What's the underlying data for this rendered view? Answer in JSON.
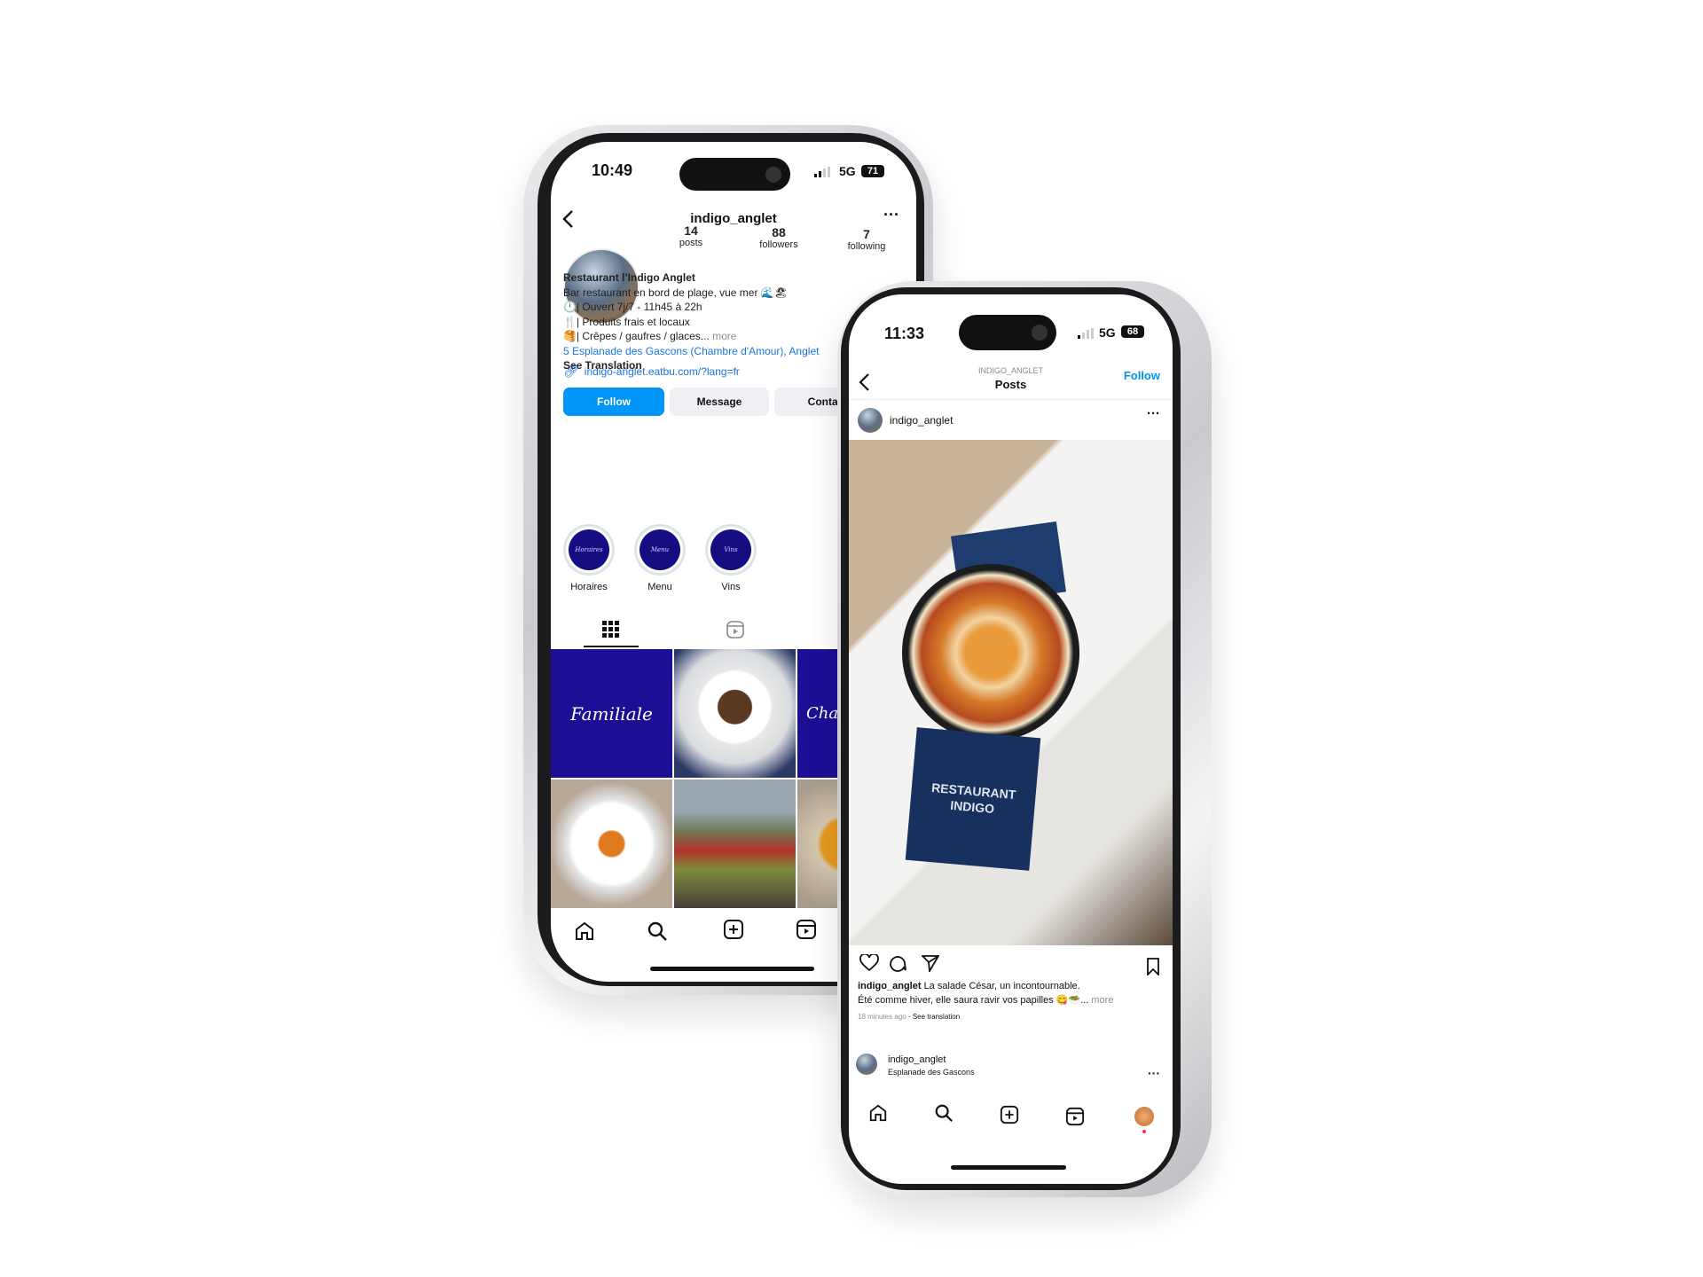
{
  "profile_phone": {
    "status": {
      "time": "10:49",
      "network": "5G",
      "battery": "71"
    },
    "header": {
      "username": "indigo_anglet"
    },
    "stats": [
      {
        "value": "14",
        "label": "posts"
      },
      {
        "value": "88",
        "label": "followers"
      },
      {
        "value": "7",
        "label": "following"
      }
    ],
    "bio": {
      "name": "Restaurant l’Indigo Anglet",
      "lines": [
        "Bar restaurant en bord de plage, vue mer 🌊🏖",
        "🕛| Ouvert 7j/7 - 11h45 à 22h",
        "🍴| Produits frais et locaux",
        "🥞| Crêpes / gaufres / glaces..."
      ],
      "more": "more",
      "address": "5 Esplanade des Gascons (Chambre d'Amour), Anglet",
      "see_translation": "See Translation",
      "link": "indigo-anglet.eatbu.com/?lang=fr"
    },
    "buttons": {
      "follow": "Follow",
      "message": "Message",
      "contact": "Contact"
    },
    "highlights": [
      {
        "label": "Horaires",
        "cover": "Horaires"
      },
      {
        "label": "Menu",
        "cover": "Menu"
      },
      {
        "label": "Vins",
        "cover": "Vins"
      }
    ],
    "grid_posts": [
      {
        "type": "text-card",
        "text": "Familiale"
      },
      {
        "type": "photo",
        "subject": "plate"
      },
      {
        "type": "text-card",
        "text": "Char"
      },
      {
        "type": "photo",
        "subject": "dessert"
      },
      {
        "type": "photo",
        "subject": "cocktails"
      },
      {
        "type": "photo",
        "subject": "soup"
      }
    ],
    "accent": "#0095f6",
    "brand": "#170d83"
  },
  "post_phone": {
    "status": {
      "time": "11:33",
      "network": "5G",
      "battery": "68"
    },
    "header": {
      "account": "INDIGO_ANGLET",
      "title": "Posts",
      "follow": "Follow"
    },
    "post": {
      "username": "indigo_anglet",
      "photo_text": "RESTAURANT INDIGO",
      "caption_user": "indigo_anglet",
      "caption_line1": "La salade César, un incontournable.",
      "caption_line2": "Été comme hiver, elle saura ravir vos papilles 😋🥗...",
      "more": "more",
      "time": "18 minutes ago",
      "see_translation": "See translation"
    },
    "next_post": {
      "username": "indigo_anglet",
      "location": "Esplanade des Gascons"
    }
  }
}
